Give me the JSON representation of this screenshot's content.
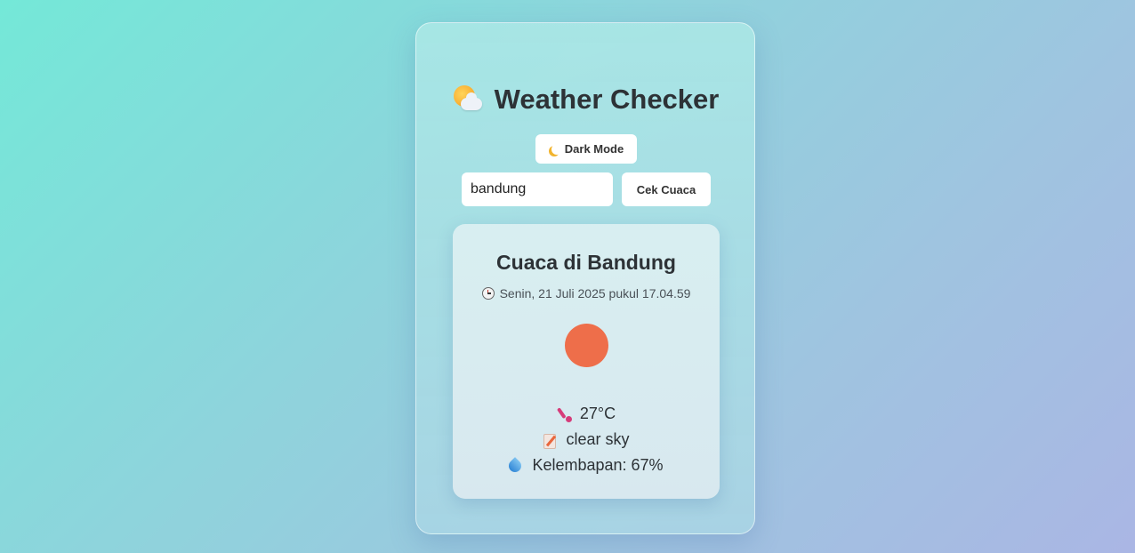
{
  "app": {
    "title": "Weather Checker",
    "title_icon": "sun-behind-cloud-icon"
  },
  "toolbar": {
    "dark_mode_label": "Dark Mode",
    "dark_mode_icon": "crescent-moon-icon"
  },
  "search": {
    "value": "bandung",
    "button_label": "Cek Cuaca"
  },
  "result": {
    "title": "Cuaca di Bandung",
    "datetime": "Senin, 21 Juli 2025 pukul 17.04.59",
    "datetime_icon": "clock-icon",
    "weather_icon": "sun-icon",
    "temperature": "27°C",
    "temperature_icon": "thermometer-icon",
    "description": "clear sky",
    "description_icon": "memo-icon",
    "humidity": "Kelembapan: 67%",
    "humidity_icon": "droplet-icon"
  },
  "colors": {
    "background_start": "#74e8d8",
    "background_end": "#aab6e4",
    "sun": "#ee6e4a",
    "text": "#2d3236"
  }
}
